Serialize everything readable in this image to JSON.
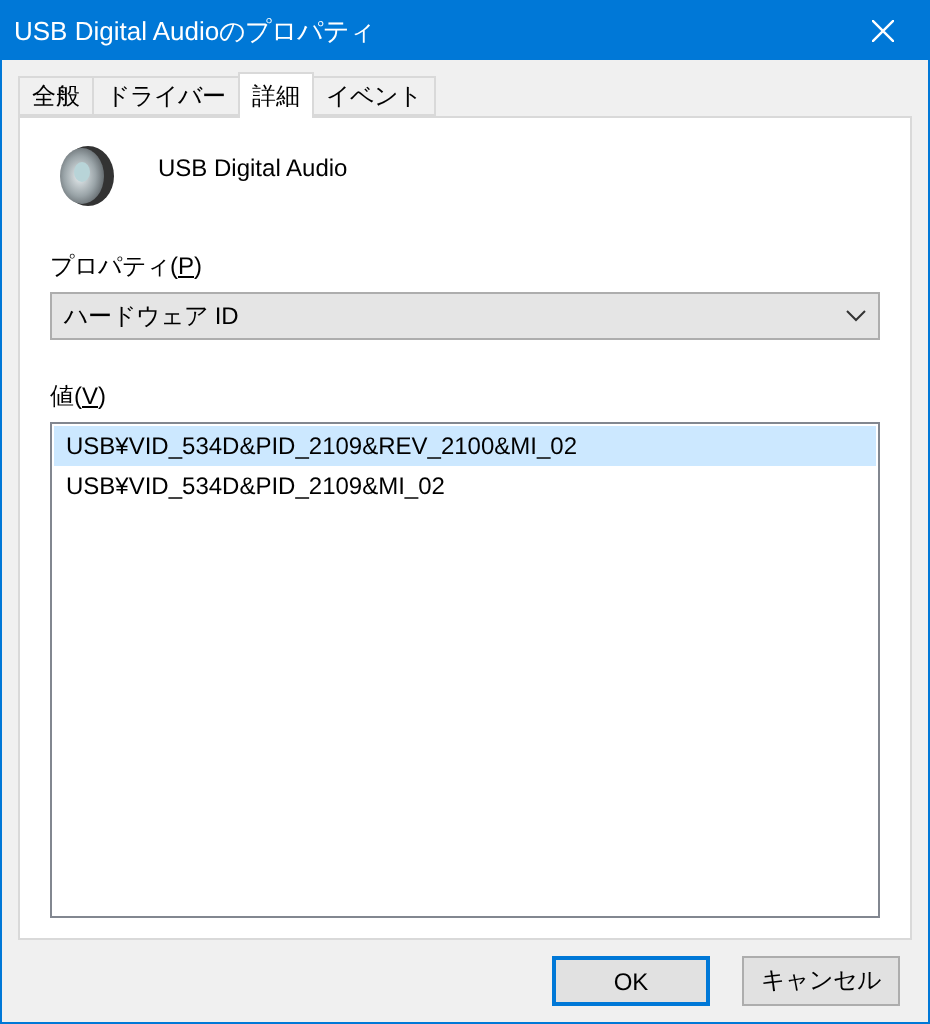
{
  "window": {
    "title": "USB Digital Audioのプロパティ"
  },
  "tabs": [
    {
      "label": "全般",
      "selected": false
    },
    {
      "label": "ドライバー",
      "selected": false
    },
    {
      "label": "詳細",
      "selected": true
    },
    {
      "label": "イベント",
      "selected": false
    }
  ],
  "device": {
    "name": "USB Digital Audio"
  },
  "property": {
    "label": "プロパティ(",
    "mnemonic": "P",
    "label_end": ")",
    "value": "ハードウェア ID"
  },
  "values": {
    "label": "値(",
    "mnemonic": "V",
    "label_end": ")",
    "items": [
      {
        "text": "USB¥VID_534D&PID_2109&REV_2100&MI_02",
        "selected": true
      },
      {
        "text": "USB¥VID_534D&PID_2109&MI_02",
        "selected": false
      }
    ]
  },
  "buttons": [
    {
      "label": "OK",
      "default": true
    },
    {
      "label": "キャンセル",
      "default": false
    }
  ]
}
